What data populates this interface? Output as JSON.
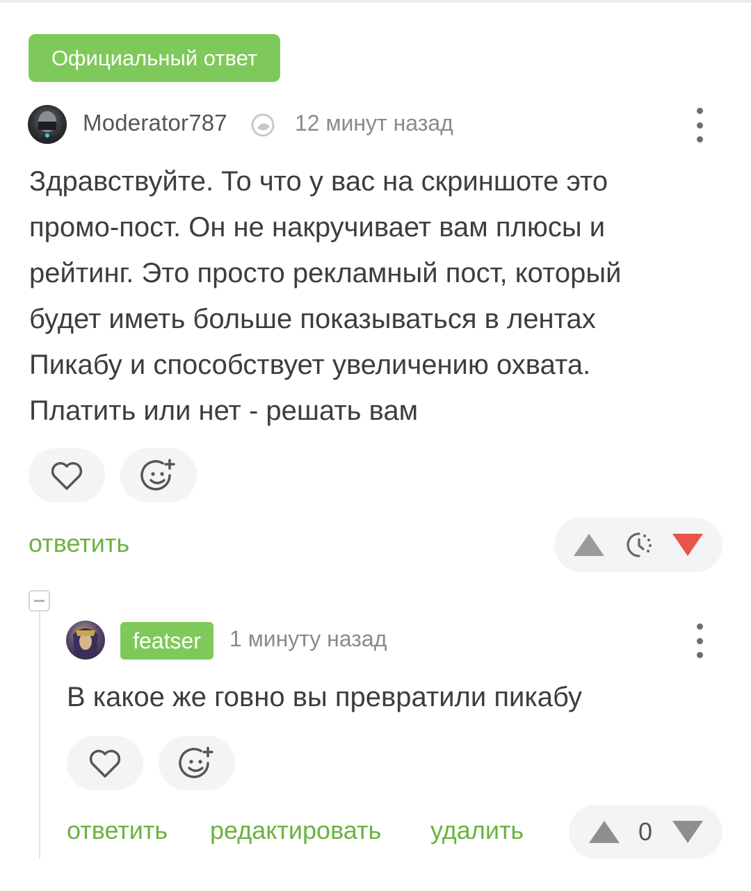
{
  "official_badge": "Официальный ответ",
  "comment": {
    "author": "Moderator787",
    "time": "12 минут назад",
    "lines": [
      "Здравствуйте. То что у вас на скриншоте это",
      "промо-пост. Он не накручивает вам плюсы и",
      "рейтинг. Это просто рекламный пост, который",
      "будет иметь больше показываться в лентах",
      "Пикабу и способствует увеличению охвата.",
      "Платить или нет - решать вам"
    ],
    "reply_label": "ответить"
  },
  "reply": {
    "author": "featser",
    "time": "1 минуту назад",
    "text": "В какое же говно вы превратили пикабу",
    "actions": {
      "reply": "ответить",
      "edit": "редактировать",
      "delete": "удалить"
    },
    "score": "0"
  },
  "icons": {
    "like": "heart-icon",
    "emoji": "add-emoji-icon",
    "more": "more-vertical-icon",
    "upvote": "triangle-up-icon",
    "downvote": "triangle-down-icon",
    "pending": "clock-icon",
    "moderator": "moderator-icon",
    "collapse": "collapse-minus-icon"
  },
  "colors": {
    "accent_green": "#7ec95a",
    "link_green": "#6bb23f",
    "downvote_red": "#e9534a",
    "vote_gray": "#9a9a9a"
  }
}
